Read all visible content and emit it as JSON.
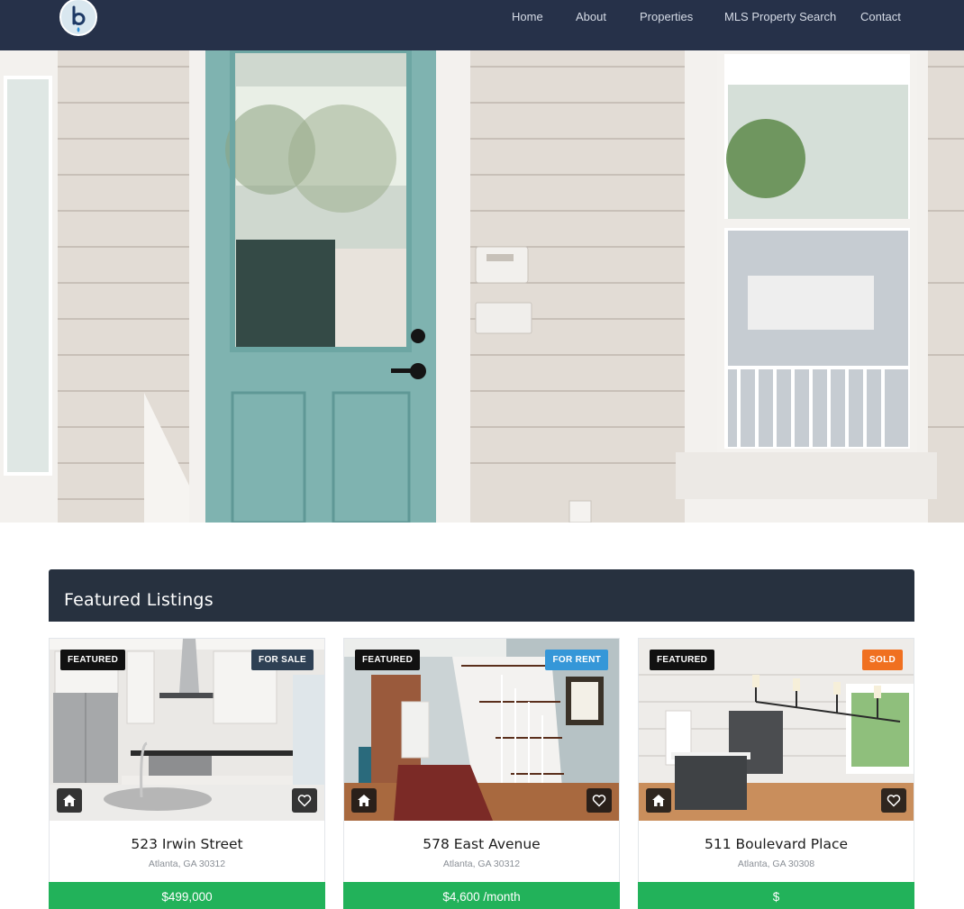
{
  "nav": {
    "logo_letter": "b",
    "links": [
      "Home",
      "About",
      "Properties",
      "MLS Property Search",
      "Contact"
    ]
  },
  "featured": {
    "title": "Featured Listings",
    "listings": [
      {
        "badge": "FEATURED",
        "status": "FOR SALE",
        "status_color": "#2e4054",
        "address": "523 Irwin Street",
        "city": "Atlanta, GA 30312",
        "price": "$499,000"
      },
      {
        "badge": "FEATURED",
        "status": "FOR RENT",
        "status_color": "#3597d8",
        "address": "578 East Avenue",
        "city": "Atlanta, GA 30312",
        "price": "$4,600 /month"
      },
      {
        "badge": "FEATURED",
        "status": "SOLD",
        "status_color": "#f07020",
        "address": "511 Boulevard Place",
        "city": "Atlanta, GA 30308",
        "price": "$"
      }
    ]
  },
  "colors": {
    "nav_bg": "#263149",
    "section_header_bg": "#27313f",
    "price_bar": "#22b25a"
  },
  "icons": [
    "home-icon",
    "heart-icon"
  ]
}
